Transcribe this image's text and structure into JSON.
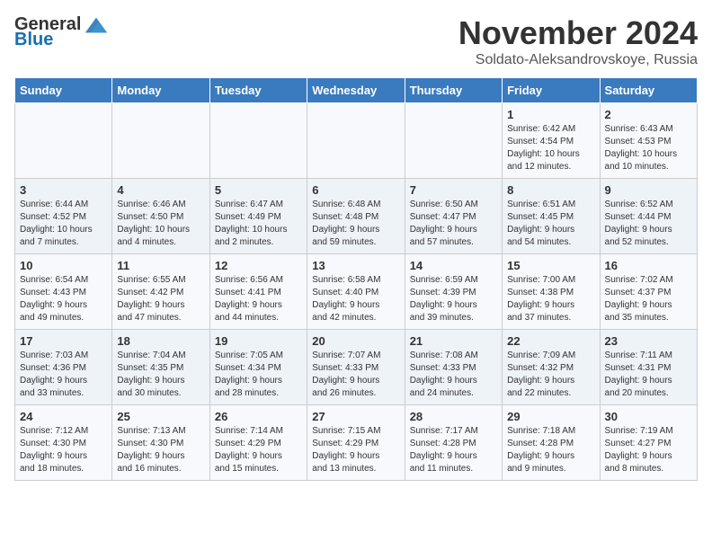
{
  "header": {
    "logo_general": "General",
    "logo_blue": "Blue",
    "month_title": "November 2024",
    "subtitle": "Soldato-Aleksandrovskoye, Russia"
  },
  "weekdays": [
    "Sunday",
    "Monday",
    "Tuesday",
    "Wednesday",
    "Thursday",
    "Friday",
    "Saturday"
  ],
  "weeks": [
    [
      {
        "day": "",
        "info": ""
      },
      {
        "day": "",
        "info": ""
      },
      {
        "day": "",
        "info": ""
      },
      {
        "day": "",
        "info": ""
      },
      {
        "day": "",
        "info": ""
      },
      {
        "day": "1",
        "info": "Sunrise: 6:42 AM\nSunset: 4:54 PM\nDaylight: 10 hours\nand 12 minutes."
      },
      {
        "day": "2",
        "info": "Sunrise: 6:43 AM\nSunset: 4:53 PM\nDaylight: 10 hours\nand 10 minutes."
      }
    ],
    [
      {
        "day": "3",
        "info": "Sunrise: 6:44 AM\nSunset: 4:52 PM\nDaylight: 10 hours\nand 7 minutes."
      },
      {
        "day": "4",
        "info": "Sunrise: 6:46 AM\nSunset: 4:50 PM\nDaylight: 10 hours\nand 4 minutes."
      },
      {
        "day": "5",
        "info": "Sunrise: 6:47 AM\nSunset: 4:49 PM\nDaylight: 10 hours\nand 2 minutes."
      },
      {
        "day": "6",
        "info": "Sunrise: 6:48 AM\nSunset: 4:48 PM\nDaylight: 9 hours\nand 59 minutes."
      },
      {
        "day": "7",
        "info": "Sunrise: 6:50 AM\nSunset: 4:47 PM\nDaylight: 9 hours\nand 57 minutes."
      },
      {
        "day": "8",
        "info": "Sunrise: 6:51 AM\nSunset: 4:45 PM\nDaylight: 9 hours\nand 54 minutes."
      },
      {
        "day": "9",
        "info": "Sunrise: 6:52 AM\nSunset: 4:44 PM\nDaylight: 9 hours\nand 52 minutes."
      }
    ],
    [
      {
        "day": "10",
        "info": "Sunrise: 6:54 AM\nSunset: 4:43 PM\nDaylight: 9 hours\nand 49 minutes."
      },
      {
        "day": "11",
        "info": "Sunrise: 6:55 AM\nSunset: 4:42 PM\nDaylight: 9 hours\nand 47 minutes."
      },
      {
        "day": "12",
        "info": "Sunrise: 6:56 AM\nSunset: 4:41 PM\nDaylight: 9 hours\nand 44 minutes."
      },
      {
        "day": "13",
        "info": "Sunrise: 6:58 AM\nSunset: 4:40 PM\nDaylight: 9 hours\nand 42 minutes."
      },
      {
        "day": "14",
        "info": "Sunrise: 6:59 AM\nSunset: 4:39 PM\nDaylight: 9 hours\nand 39 minutes."
      },
      {
        "day": "15",
        "info": "Sunrise: 7:00 AM\nSunset: 4:38 PM\nDaylight: 9 hours\nand 37 minutes."
      },
      {
        "day": "16",
        "info": "Sunrise: 7:02 AM\nSunset: 4:37 PM\nDaylight: 9 hours\nand 35 minutes."
      }
    ],
    [
      {
        "day": "17",
        "info": "Sunrise: 7:03 AM\nSunset: 4:36 PM\nDaylight: 9 hours\nand 33 minutes."
      },
      {
        "day": "18",
        "info": "Sunrise: 7:04 AM\nSunset: 4:35 PM\nDaylight: 9 hours\nand 30 minutes."
      },
      {
        "day": "19",
        "info": "Sunrise: 7:05 AM\nSunset: 4:34 PM\nDaylight: 9 hours\nand 28 minutes."
      },
      {
        "day": "20",
        "info": "Sunrise: 7:07 AM\nSunset: 4:33 PM\nDaylight: 9 hours\nand 26 minutes."
      },
      {
        "day": "21",
        "info": "Sunrise: 7:08 AM\nSunset: 4:33 PM\nDaylight: 9 hours\nand 24 minutes."
      },
      {
        "day": "22",
        "info": "Sunrise: 7:09 AM\nSunset: 4:32 PM\nDaylight: 9 hours\nand 22 minutes."
      },
      {
        "day": "23",
        "info": "Sunrise: 7:11 AM\nSunset: 4:31 PM\nDaylight: 9 hours\nand 20 minutes."
      }
    ],
    [
      {
        "day": "24",
        "info": "Sunrise: 7:12 AM\nSunset: 4:30 PM\nDaylight: 9 hours\nand 18 minutes."
      },
      {
        "day": "25",
        "info": "Sunrise: 7:13 AM\nSunset: 4:30 PM\nDaylight: 9 hours\nand 16 minutes."
      },
      {
        "day": "26",
        "info": "Sunrise: 7:14 AM\nSunset: 4:29 PM\nDaylight: 9 hours\nand 15 minutes."
      },
      {
        "day": "27",
        "info": "Sunrise: 7:15 AM\nSunset: 4:29 PM\nDaylight: 9 hours\nand 13 minutes."
      },
      {
        "day": "28",
        "info": "Sunrise: 7:17 AM\nSunset: 4:28 PM\nDaylight: 9 hours\nand 11 minutes."
      },
      {
        "day": "29",
        "info": "Sunrise: 7:18 AM\nSunset: 4:28 PM\nDaylight: 9 hours\nand 9 minutes."
      },
      {
        "day": "30",
        "info": "Sunrise: 7:19 AM\nSunset: 4:27 PM\nDaylight: 9 hours\nand 8 minutes."
      }
    ]
  ]
}
